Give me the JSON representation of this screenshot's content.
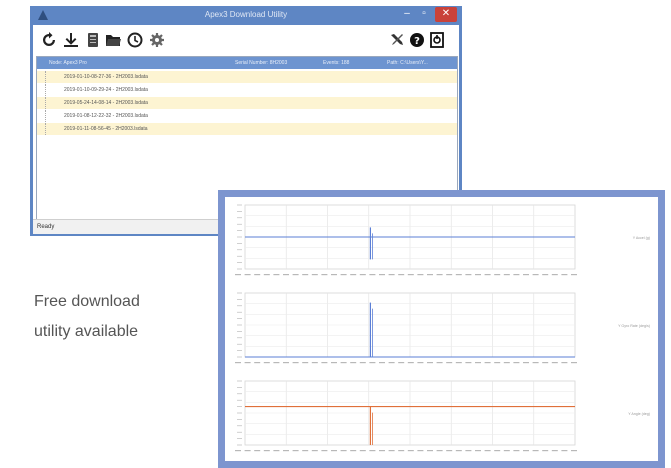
{
  "window": {
    "title": "Apex3 Download Utility",
    "buttons": {
      "minimize": "–",
      "maximize": "▫",
      "close": "✕"
    }
  },
  "toolbar": {
    "left_icons": [
      "refresh-icon",
      "download-icon",
      "card-icon",
      "folder-icon",
      "clock-icon",
      "settings-icon"
    ],
    "right_icons": [
      "tools-icon",
      "help-icon",
      "exit-icon"
    ]
  },
  "grid": {
    "columns": [
      "Node: Apex3 Pro",
      "Serial Number: 8H2003",
      "Events: 188",
      "Path: C:\\Users\\Y..."
    ],
    "rows": [
      "2019-01-10-08-27-36 - 2H2003.lsdata",
      "2019-01-10-09-29-24 - 2H2003.lsdata",
      "2019-05-24-14-08-14 - 2H2003.lsdata",
      "2019-01-08-12-22-32 - 2H2003.lsdata",
      "2019-01-11-08-56-45 - 2H2003.lsdata"
    ]
  },
  "status": {
    "text": "Ready"
  },
  "caption": {
    "line1": "Free download",
    "line2": "utility available"
  },
  "chart_data": [
    {
      "type": "line",
      "series": [
        {
          "name": "Y Accel (g)",
          "color": "#5b7fd6"
        }
      ],
      "spike": {
        "position": 0.38,
        "min": -0.7,
        "max": 0.3
      },
      "baseline": 0.0,
      "ylim": [
        -1,
        1
      ]
    },
    {
      "type": "line",
      "series": [
        {
          "name": "Y Gyro Rate (deg/s)",
          "color": "#5b7fd6"
        }
      ],
      "spike": {
        "position": 0.38,
        "min": 0.0,
        "max": 0.85
      },
      "baseline": 0.0,
      "ylim": [
        0,
        1
      ]
    },
    {
      "type": "line",
      "series": [
        {
          "name": "Y Angle (deg)",
          "color": "#e0703a"
        }
      ],
      "spike": {
        "position": 0.38,
        "min": 0.0,
        "max": 0.6
      },
      "baseline": 0.6,
      "ylim": [
        0,
        1
      ]
    }
  ]
}
